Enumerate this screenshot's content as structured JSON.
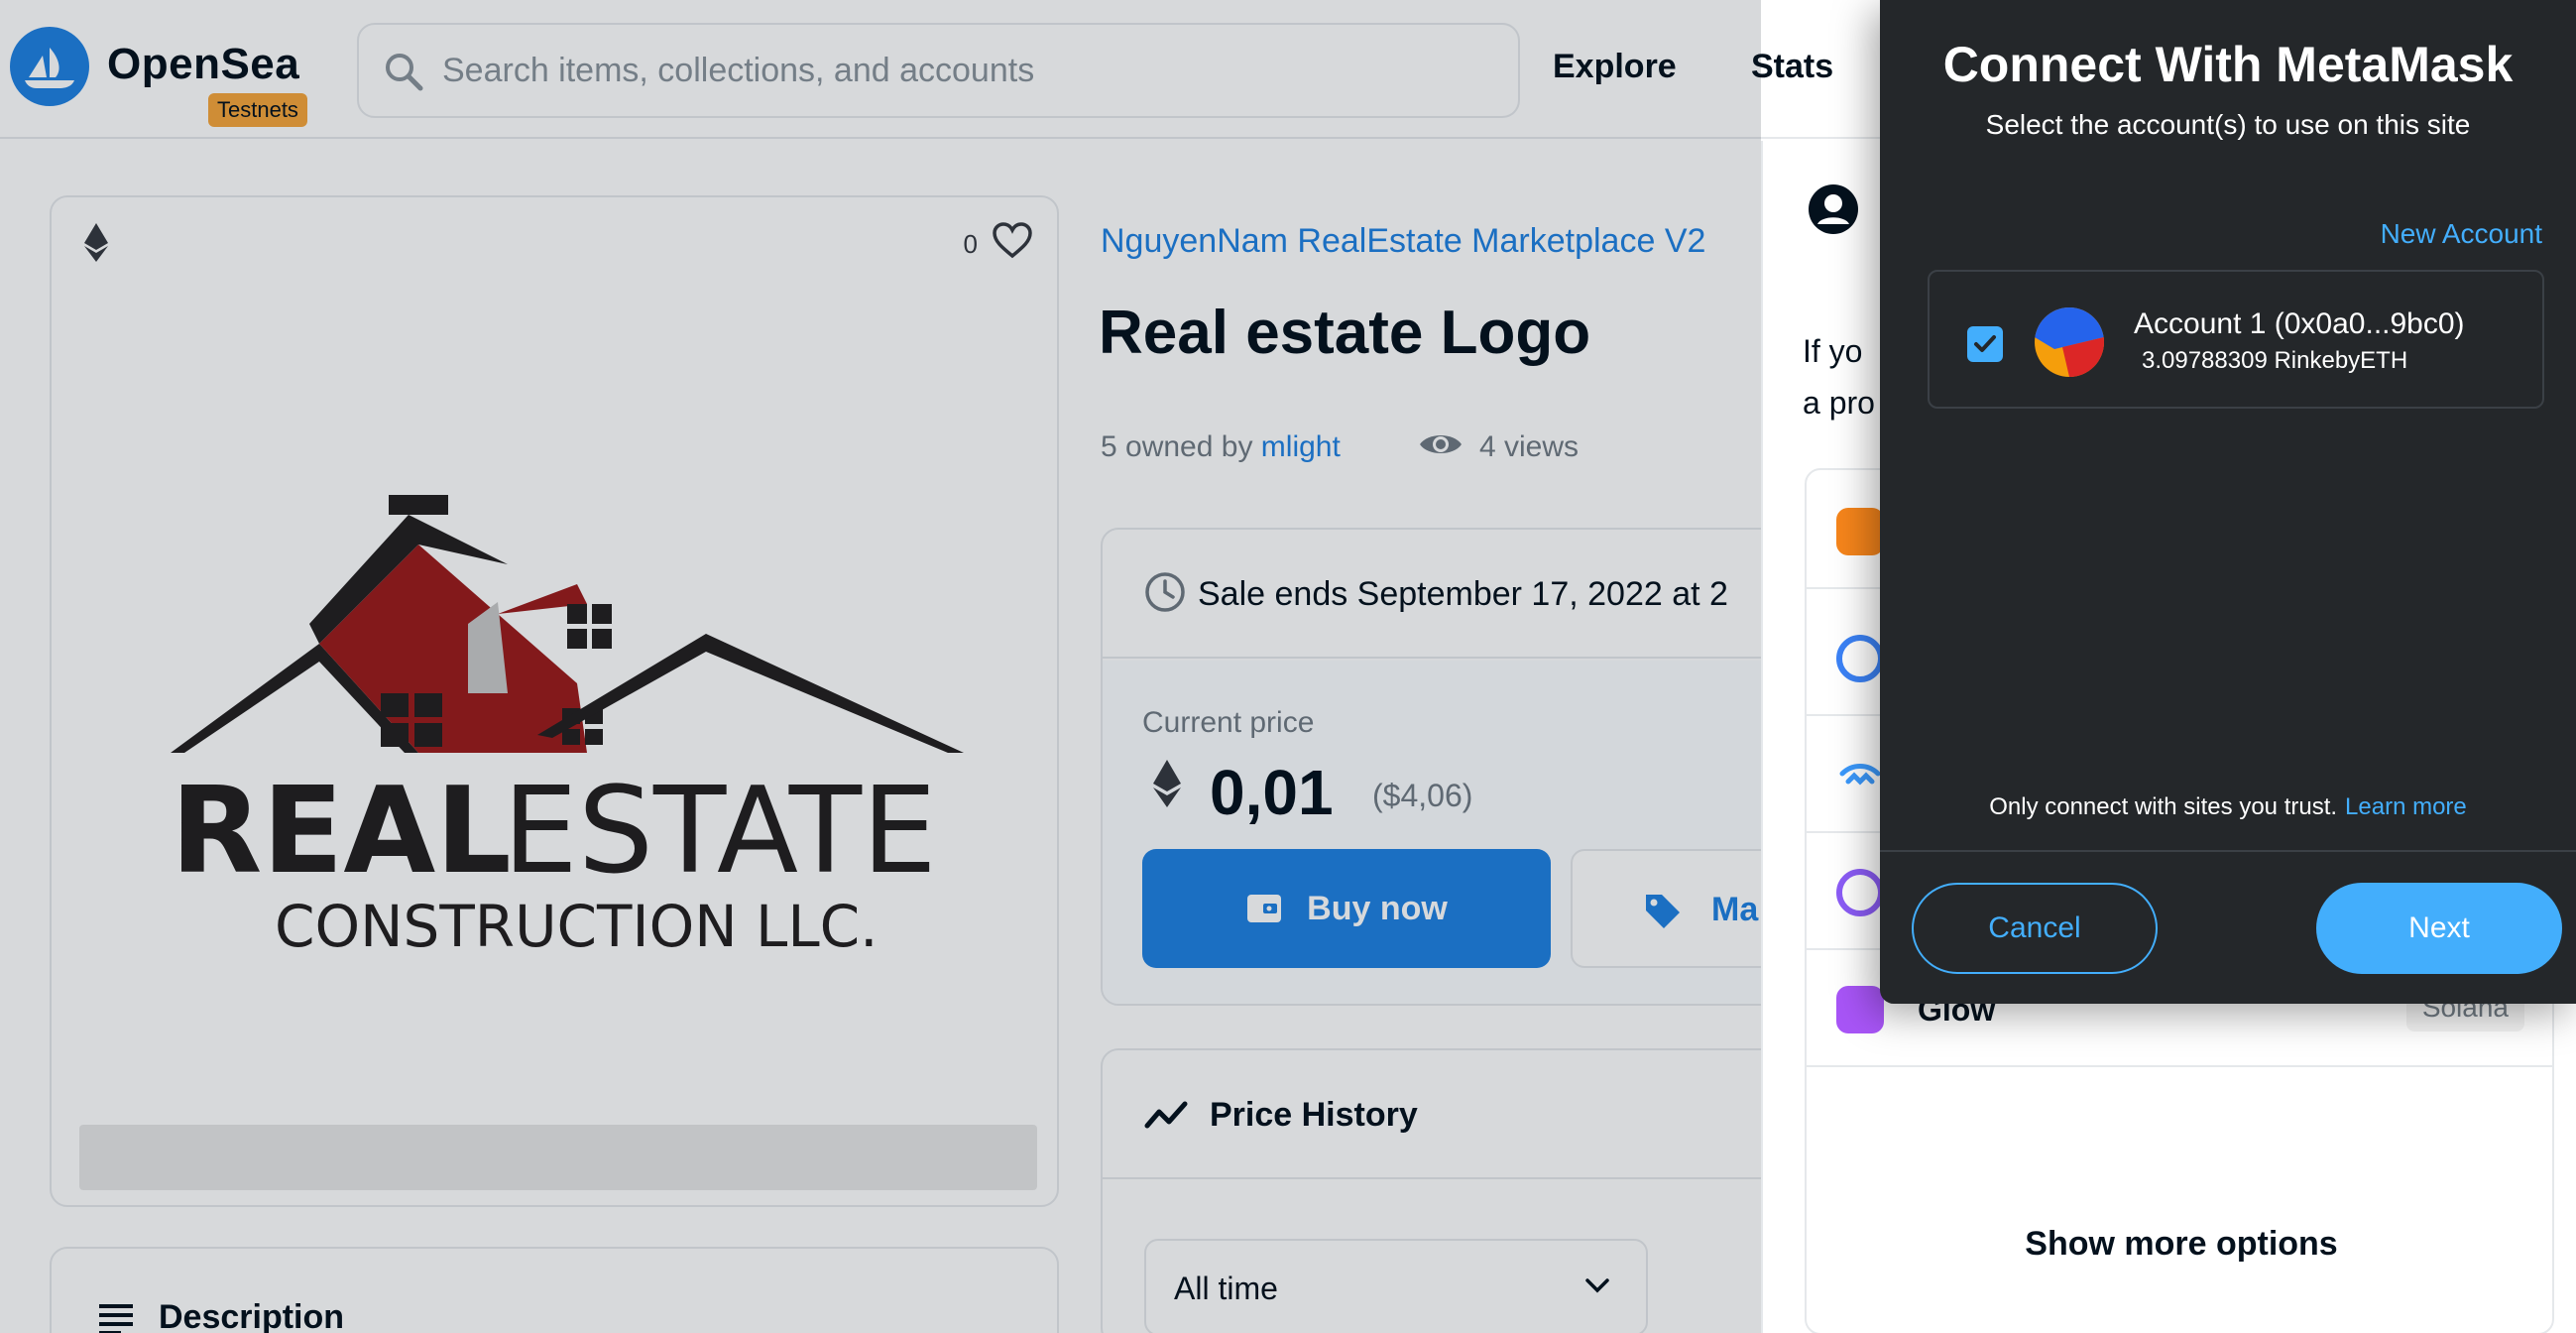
{
  "header": {
    "brand": "OpenSea",
    "badge": "Testnets",
    "search_placeholder": "Search items, collections, and accounts",
    "nav": [
      "Explore",
      "Stats"
    ]
  },
  "asset": {
    "favorites": "0",
    "logo_text": {
      "line1_bold": "REAL",
      "line1_light": "ESTATE",
      "line2": "CONSTRUCTION LLC."
    },
    "description_title": "Description",
    "collection": "NguyenNam RealEstate Marketplace V2",
    "title": "Real estate Logo",
    "owned_prefix": "5 owned by",
    "owner": "mlight",
    "views": "4 views",
    "sale_ends": "Sale ends September 17, 2022 at 2",
    "current_price_label": "Current price",
    "price": "0,01",
    "price_usd": "($4,06)",
    "buy_label": "Buy now",
    "offer_label": "Ma",
    "price_history_label": "Price History",
    "period_selected": "All time"
  },
  "wallet_panel": {
    "intro_text_line1": "If yo",
    "intro_text_line2": "a pro",
    "wallets": [
      {
        "name": "",
        "chain": "",
        "color": "#f6851b"
      },
      {
        "name": "",
        "chain": "",
        "color": "#3b82f6"
      },
      {
        "name": "",
        "chain": "",
        "color": "#3b99fc"
      },
      {
        "name": "",
        "chain": "",
        "color": "#8b5cf6"
      },
      {
        "name": "Glow",
        "chain": "Solana",
        "color": "#a855f7"
      }
    ],
    "show_more": "Show more options"
  },
  "metamask": {
    "title": "Connect With MetaMask",
    "subtitle": "Select the account(s) to use on this site",
    "new_account": "New Account",
    "account_name": "Account 1 (0x0a0...9bc0)",
    "account_balance": "3.09788309 RinkebyETH",
    "trust_text": "Only connect with sites you trust.",
    "learn_more": "Learn more",
    "cancel": "Cancel",
    "next": "Next"
  },
  "colors": {
    "accent": "#2081e2",
    "metamask_bg": "#24272a",
    "metamask_blue": "#43aefc",
    "badge": "#f6a53b",
    "logo_red": "#9b1b1b"
  },
  "icons": [
    "opensea-logo-icon",
    "search-icon",
    "ethereum-icon",
    "heart-icon",
    "eye-icon",
    "clock-icon",
    "wallet-icon",
    "tag-icon",
    "trend-icon",
    "menu-lines-icon",
    "chevron-down-icon",
    "user-icon",
    "check-icon"
  ]
}
